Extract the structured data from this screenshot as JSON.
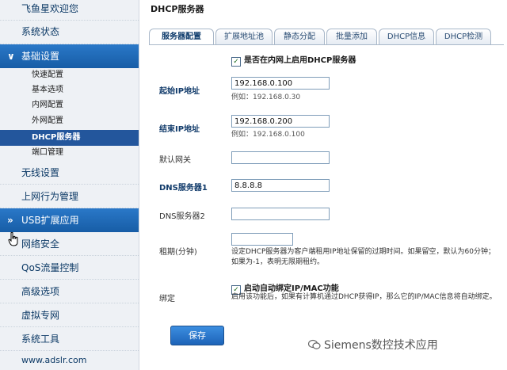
{
  "sidebar": {
    "welcome": "飞鱼星欢迎您",
    "status": "系统状态",
    "basic_settings": "基础设置",
    "basic_sub": [
      "快速配置",
      "基本选项",
      "内网配置",
      "外网配置",
      "DHCP服务器",
      "端口管理"
    ],
    "wireless": "无线设置",
    "behavior": "上网行为管理",
    "usb": "USB扩展应用",
    "security": "网络安全",
    "qos": "QoS流量控制",
    "advanced": "高级选项",
    "vpn": "虚拟专网",
    "tools": "系统工具",
    "website": "www.adslr.com"
  },
  "page": {
    "title": "DHCP服务器",
    "tabs": [
      "服务器配置",
      "扩展地址池",
      "静态分配",
      "批量添加",
      "DHCP信息",
      "DHCP检测"
    ]
  },
  "form": {
    "enable_label": "是否在内网上启用DHCP服务器",
    "start_ip_label": "起始IP地址",
    "start_ip_value": "192.168.0.100",
    "start_ip_example": "例如：192.168.0.30",
    "end_ip_label": "结束IP地址",
    "end_ip_value": "192.168.0.200",
    "end_ip_example": "例如：192.168.0.100",
    "gateway_label": "默认网关",
    "gateway_value": "",
    "dns1_label": "DNS服务器1",
    "dns1_value": "8.8.8.8",
    "dns2_label": "DNS服务器2",
    "dns2_value": "",
    "lease_label": "租期(分钟)",
    "lease_value": "",
    "lease_desc": "设定DHCP服务器为客户端租用IP地址保留的过期时间。如果留空，默认为60分钟；如果为-1，表明无限期租约。",
    "bind_label": "绑定",
    "bind_check_label": "启动自动绑定IP/MAC功能",
    "bind_desc": "启用该功能后，如果有计算机通过DHCP获得IP，那么它的IP/MAC信息将自动绑定。",
    "save_label": "保存"
  },
  "watermark": "Siemens数控技术应用",
  "colors": {
    "accent": "#1d63b8",
    "active_sub": "#23569c",
    "sidebar_bg": "#eef1f5"
  }
}
